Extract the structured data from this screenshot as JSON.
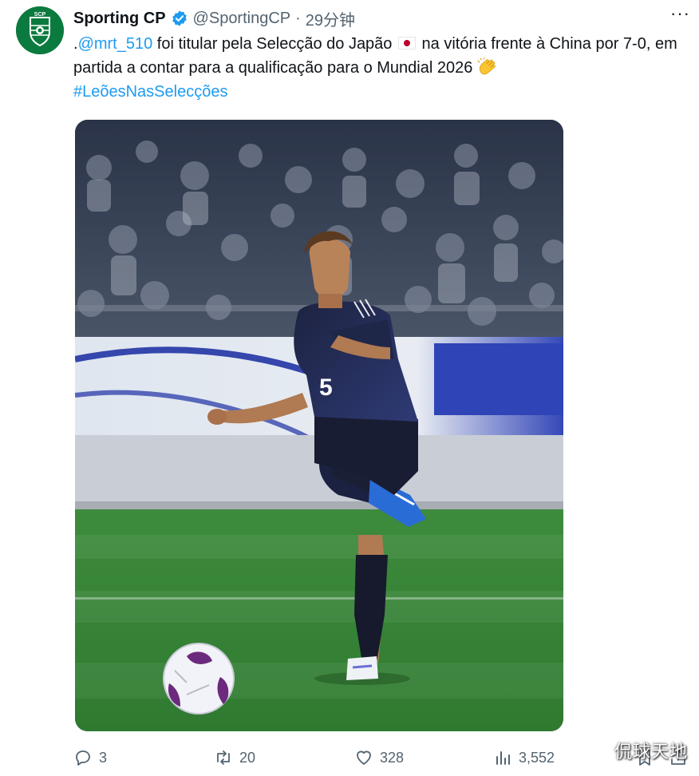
{
  "tweet": {
    "display_name": "Sporting CP",
    "handle": "@SportingCP",
    "separator": "·",
    "time": "29分钟",
    "text": {
      "prefix": ".",
      "mention": "@mrt_510",
      "part1": " foi titular pela Selecção do Japão ",
      "part2": " na vitória frente à China por ",
      "score": "7-0",
      "part3": ", em partida a contar para a qualificação para o Mundial 2026 ",
      "hashtag": "#LeõesNasSelecções"
    },
    "icons": {
      "verified": "verified-badge-icon",
      "flag": "japan-flag-icon",
      "clap": "clapping-hands-icon",
      "more": "more-options-icon"
    }
  },
  "media": {
    "image": "photo-footballer-japan-number-5-kicking-ball"
  },
  "actions": {
    "replies": "3",
    "retweets": "20",
    "likes": "328",
    "views": "3,552"
  },
  "watermark": "侃球天地",
  "colors": {
    "link": "#1d9bf0",
    "secondary_text": "#536471",
    "verified": "#1d9bf0",
    "sporting_green": "#0b7a3e"
  }
}
